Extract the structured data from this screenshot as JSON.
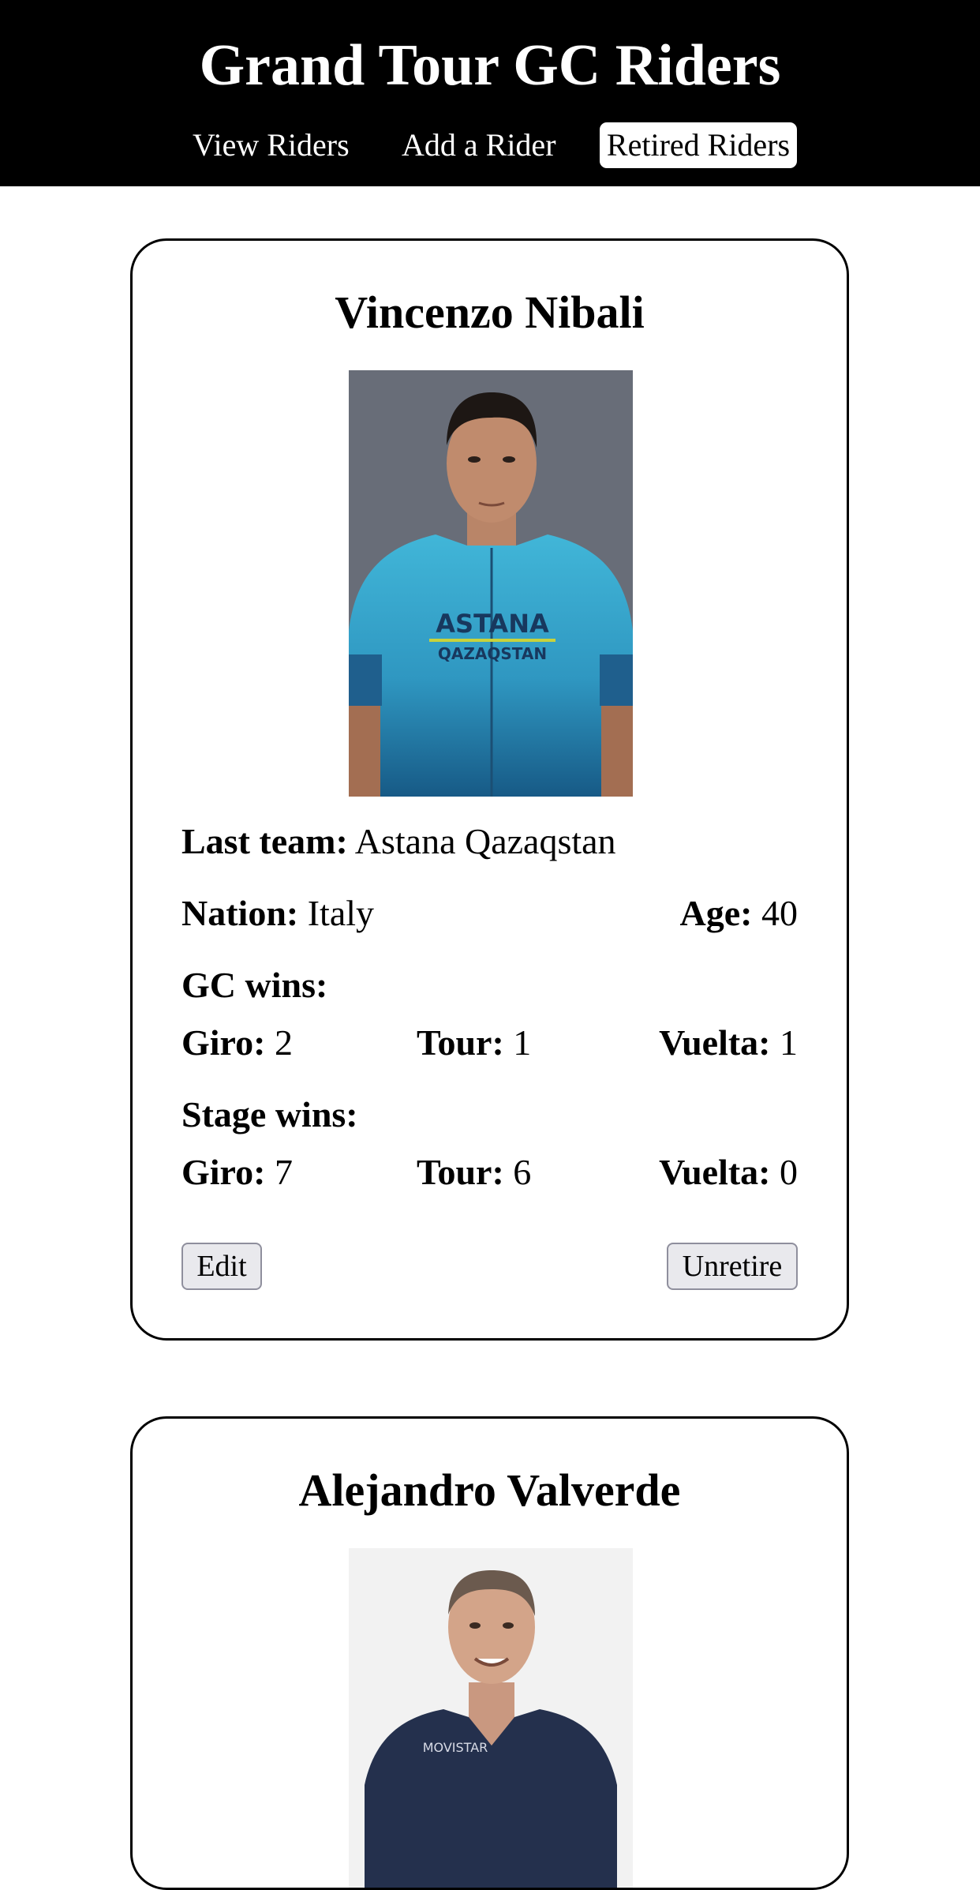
{
  "header": {
    "title": "Grand Tour GC Riders",
    "nav": [
      {
        "label": "View Riders"
      },
      {
        "label": "Add a Rider"
      },
      {
        "label": "Retired Riders",
        "active": true
      }
    ]
  },
  "labels": {
    "last_team": "Last team:",
    "nation": "Nation:",
    "age": "Age:",
    "gc_wins": "GC wins:",
    "stage_wins": "Stage wins:",
    "giro": "Giro:",
    "tour": "Tour:",
    "vuelta": "Vuelta:"
  },
  "riders": [
    {
      "name": "Vincenzo Nibali",
      "photo_jersey_text_1": "ASTANA",
      "photo_jersey_text_2": "QAZAQSTAN",
      "last_team": "Astana Qazaqstan",
      "nation": "Italy",
      "age": "40",
      "gc_wins": {
        "giro": "2",
        "tour": "1",
        "vuelta": "1"
      },
      "stage_wins": {
        "giro": "7",
        "tour": "6",
        "vuelta": "0"
      },
      "edit_label": "Edit",
      "unretire_label": "Unretire"
    },
    {
      "name": "Alejandro Valverde",
      "photo_jersey_text_1": "MOVISTAR"
    }
  ]
}
